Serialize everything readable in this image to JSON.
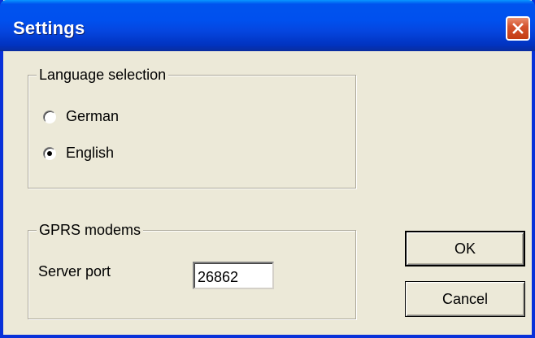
{
  "window": {
    "title": "Settings"
  },
  "language_group": {
    "legend": "Language selection",
    "options": [
      {
        "label": "German",
        "checked": false
      },
      {
        "label": "English",
        "checked": true
      }
    ]
  },
  "gprs_group": {
    "legend": "GPRS modems",
    "server_port_label": "Server port",
    "server_port_value": "26862"
  },
  "buttons": {
    "ok_label": "OK",
    "cancel_label": "Cancel"
  },
  "colors": {
    "titlebar": "#0053ee",
    "close_button": "#d4532e",
    "dialog_background": "#ece9d8"
  }
}
